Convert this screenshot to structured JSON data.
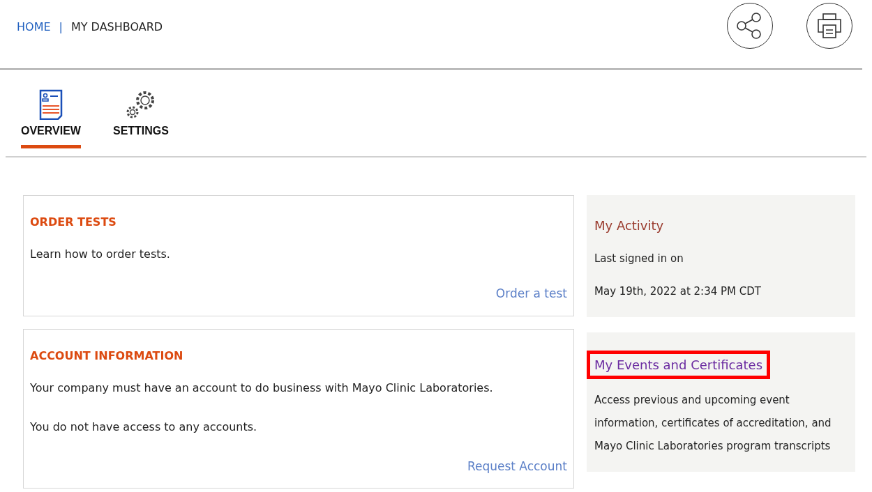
{
  "breadcrumb_separator": "|",
  "breadcrumb": [
    {
      "label": "HOME",
      "kind": "link"
    },
    {
      "label": "MY DASHBOARD",
      "kind": "current"
    }
  ],
  "header_actions": [
    {
      "kind": "share"
    },
    {
      "kind": "print"
    }
  ],
  "tabs": [
    {
      "label": "OVERVIEW",
      "kind": "overview",
      "selected": true
    },
    {
      "label": "SETTINGS",
      "kind": "settings",
      "selected": false
    }
  ],
  "cards": [
    {
      "title": "ORDER TESTS",
      "paragraphs": [
        "Learn how to order tests."
      ],
      "link": "Order a test"
    },
    {
      "title": "ACCOUNT INFORMATION",
      "paragraphs": [
        "Your company must have an account to do business with Mayo Clinic Laboratories.",
        "You do not have access to any accounts."
      ],
      "link": "Request Account"
    }
  ],
  "panels": [
    {
      "title": "My Activity",
      "kind": "activity",
      "highlighted": false,
      "lines": [
        "Last signed in on",
        "May 19th, 2022 at 2:34 PM CDT"
      ]
    },
    {
      "title": "My Events and Certificates",
      "kind": "link",
      "highlighted": true,
      "lines": [
        "Access previous and upcoming event information, certificates of accreditation, and Mayo Clinic Laboratories program transcripts"
      ]
    }
  ]
}
